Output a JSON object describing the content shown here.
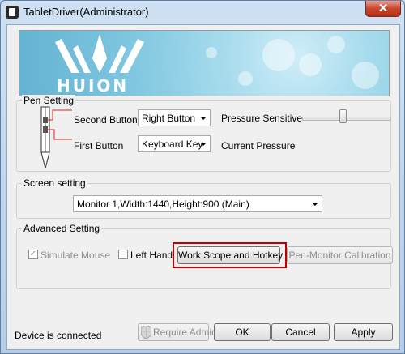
{
  "window": {
    "title": "TabletDriver(Administrator)",
    "close_glyph": "✕"
  },
  "banner": {
    "brand": "HUION"
  },
  "pen_setting": {
    "group_label": "Pen Setting",
    "second_button_label": "Second Button",
    "second_button_value": "Right Button",
    "first_button_label": "First Button",
    "first_button_value": "Keyboard Key",
    "pressure_sensitive_label": "Pressure Sensitive",
    "pressure_sensitive_level": 0.45,
    "current_pressure_label": "Current Pressure"
  },
  "screen_setting": {
    "group_label": "Screen setting",
    "monitor_value": "Monitor 1,Width:1440,Height:900 (Main)"
  },
  "advanced_setting": {
    "group_label": "Advanced Setting",
    "simulate_mouse_label": "Simulate Mouse",
    "simulate_mouse_checked": true,
    "left_hand_label": "Left Hand",
    "left_hand_checked": false,
    "work_scope_label": "Work Scope and Hotkey",
    "calibration_label": "Pen-Monitor Calibration"
  },
  "footer": {
    "status": "Device is connected",
    "require_admin_label": "Require Admin",
    "ok_label": "OK",
    "cancel_label": "Cancel",
    "apply_label": "Apply"
  },
  "colors": {
    "highlight": "#c00000",
    "banner": "#7fc6e0"
  },
  "icons": {
    "shield": "uac-shield-icon",
    "close": "close-icon"
  }
}
